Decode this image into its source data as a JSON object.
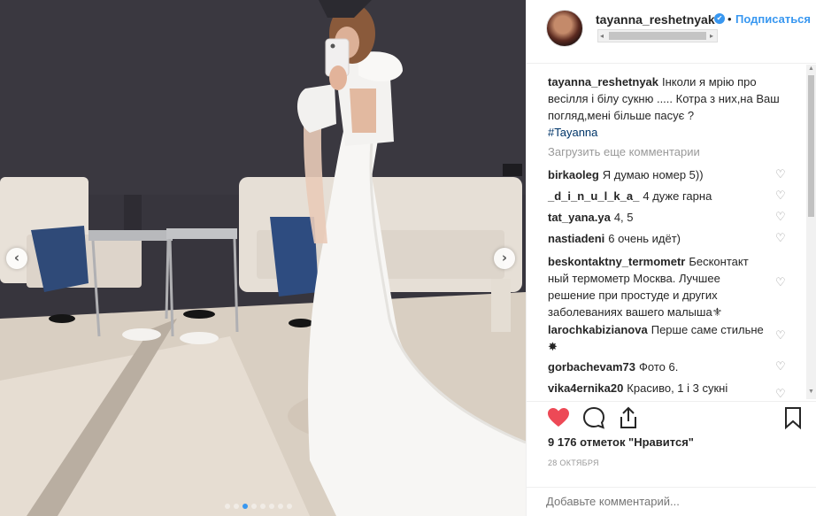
{
  "post": {
    "username": "tayanna_reshetnyak",
    "dot": "•",
    "follow_label": "Подписаться",
    "caption_text": "Інколи я мрію про весілля і білу сукню ..... Котра з них,на Ваш погляд,мені більше пасує ?",
    "caption_tag": "#Tayanna",
    "load_more": "Загрузить еще комментарии",
    "likes": "9 176 отметок \"Нравится\"",
    "date": "28 ОКТЯБРЯ",
    "add_comment_placeholder": "Добавьте комментарий..."
  },
  "comments": [
    {
      "user": "birkaoleg",
      "text": "Я думаю номер 5))"
    },
    {
      "user": "_d_i_n_u_l_k_a_",
      "text": "4 дуже гарна"
    },
    {
      "user": "tat_yana.ya",
      "text": "4, 5"
    },
    {
      "user": "nastiadeni",
      "text": "6 очень идёт)"
    },
    {
      "user": "beskontaktny_termometr",
      "text": "Бесконтакт ный термометр Москва. Лучшее решение при простуде и других заболеваниях вашего малыша⚜"
    },
    {
      "user": "larochkabizianova",
      "text": "Перше саме стильне ✸"
    },
    {
      "user": "gorbachevam73",
      "text": "Фото 6."
    },
    {
      "user": "vika4ernika20",
      "text": "Красиво, 1 і 3 сукні"
    }
  ],
  "icons": {
    "nav_left": "‹",
    "nav_right": "›",
    "comment_heart": "♡",
    "verified": "✔",
    "scroll_up": "▲",
    "scroll_down": "▼",
    "loc_left": "◂",
    "loc_right": "▸"
  },
  "colors": {
    "accent": "#3897f0",
    "like_red": "#ed4956"
  },
  "carousel": {
    "count": 8,
    "active_index": 2
  }
}
